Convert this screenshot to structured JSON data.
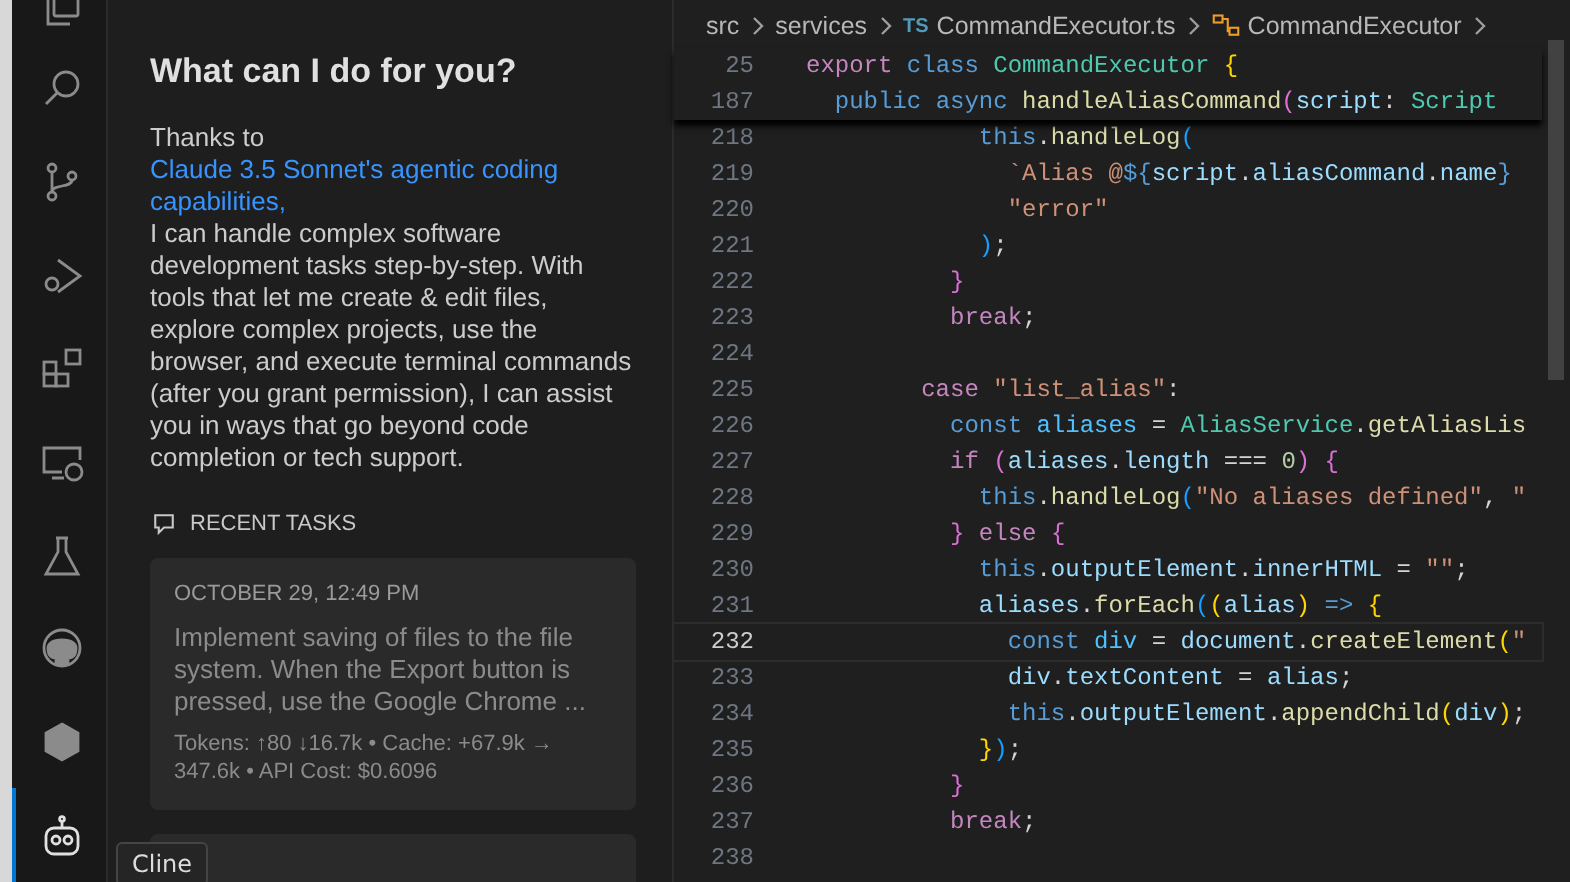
{
  "activity_bar": {
    "items": [
      {
        "kind": "files",
        "selected": false
      },
      {
        "kind": "search",
        "selected": false
      },
      {
        "kind": "git",
        "selected": false
      },
      {
        "kind": "debug",
        "selected": false
      },
      {
        "kind": "extensions",
        "selected": false
      },
      {
        "kind": "remote",
        "selected": false
      },
      {
        "kind": "flask",
        "selected": false
      },
      {
        "kind": "github",
        "selected": false
      },
      {
        "kind": "hexagon",
        "selected": false
      },
      {
        "kind": "robot",
        "selected": true
      }
    ],
    "tooltip": "Cline"
  },
  "panel": {
    "heading": "What can I do for you?",
    "intro": {
      "before": "Thanks to ",
      "link": "Claude 3.5 Sonnet's agentic coding capabilities,",
      "after": " I can handle complex software development tasks step-by-step. With tools that let me create & edit files, explore complex projects, use the browser, and execute terminal commands (after you grant permission), I can assist you in ways that go beyond code completion or tech support."
    },
    "recent_tasks_label": "RECENT TASKS",
    "tasks": [
      {
        "date": "OCTOBER 29, 12:49 PM",
        "text": "Implement saving of files to the file system. When the Export button is pressed, use the Google Chrome ...",
        "tokens": "Tokens: ↑80 ↓16.7k • Cache: +67.9k → 347.6k • API Cost: $0.6096"
      }
    ]
  },
  "editor": {
    "breadcrumb": [
      {
        "kind": "folder",
        "text": "src"
      },
      {
        "kind": "folder",
        "text": "services"
      },
      {
        "kind": "file",
        "badge": "TS",
        "text": "CommandExecutor.ts"
      },
      {
        "kind": "class",
        "text": "CommandExecutor"
      }
    ],
    "sticky": [
      {
        "n": "25",
        "tokens": [
          {
            "kind": "keyword",
            "text": "export "
          },
          {
            "kind": "storage",
            "text": "class "
          },
          {
            "kind": "type",
            "text": "CommandExecutor "
          },
          {
            "kind": "bracket1",
            "text": "{"
          }
        ]
      },
      {
        "n": "187",
        "tokens": [
          {
            "kind": "storage",
            "text": "  public "
          },
          {
            "kind": "storage",
            "text": "async "
          },
          {
            "kind": "function",
            "text": "handleAliasCommand"
          },
          {
            "kind": "bracket2",
            "text": "("
          },
          {
            "kind": "variable",
            "text": "script"
          },
          {
            "kind": "plain",
            "text": ": "
          },
          {
            "kind": "type",
            "text": "Script"
          }
        ]
      }
    ],
    "lines": [
      {
        "n": "218",
        "current": false,
        "tokens": [
          {
            "kind": "storage",
            "text": "            this"
          },
          {
            "kind": "plain",
            "text": "."
          },
          {
            "kind": "function",
            "text": "handleLog"
          },
          {
            "kind": "bracket3",
            "text": "("
          }
        ]
      },
      {
        "n": "219",
        "current": false,
        "tokens": [
          {
            "kind": "string",
            "text": "              `Alias @"
          },
          {
            "kind": "storage",
            "text": "${"
          },
          {
            "kind": "variable",
            "text": "script"
          },
          {
            "kind": "plain",
            "text": "."
          },
          {
            "kind": "variable",
            "text": "aliasCommand"
          },
          {
            "kind": "plain",
            "text": "."
          },
          {
            "kind": "variable",
            "text": "name"
          },
          {
            "kind": "storage",
            "text": "}"
          }
        ]
      },
      {
        "n": "220",
        "current": false,
        "tokens": [
          {
            "kind": "string",
            "text": "              \"error\""
          }
        ]
      },
      {
        "n": "221",
        "current": false,
        "tokens": [
          {
            "kind": "bracket3",
            "text": "            )"
          },
          {
            "kind": "plain",
            "text": ";"
          }
        ]
      },
      {
        "n": "222",
        "current": false,
        "tokens": [
          {
            "kind": "bracket2",
            "text": "          }"
          }
        ]
      },
      {
        "n": "223",
        "current": false,
        "tokens": [
          {
            "kind": "keyword",
            "text": "          break"
          },
          {
            "kind": "plain",
            "text": ";"
          }
        ]
      },
      {
        "n": "224",
        "current": false
      },
      {
        "n": "225",
        "current": false,
        "tokens": [
          {
            "kind": "keyword",
            "text": "        case "
          },
          {
            "kind": "string",
            "text": "\"list_alias\""
          },
          {
            "kind": "plain",
            "text": ":"
          }
        ]
      },
      {
        "n": "226",
        "current": false,
        "tokens": [
          {
            "kind": "storage",
            "text": "          const "
          },
          {
            "kind": "constant",
            "text": "aliases "
          },
          {
            "kind": "plain",
            "text": "= "
          },
          {
            "kind": "type",
            "text": "AliasService"
          },
          {
            "kind": "plain",
            "text": "."
          },
          {
            "kind": "function",
            "text": "getAliasLis"
          }
        ]
      },
      {
        "n": "227",
        "current": false,
        "tokens": [
          {
            "kind": "keyword",
            "text": "          if "
          },
          {
            "kind": "bracket2",
            "text": "("
          },
          {
            "kind": "variable",
            "text": "aliases"
          },
          {
            "kind": "plain",
            "text": "."
          },
          {
            "kind": "variable",
            "text": "length "
          },
          {
            "kind": "plain",
            "text": "=== "
          },
          {
            "kind": "number",
            "text": "0"
          },
          {
            "kind": "bracket2",
            "text": ") {"
          }
        ]
      },
      {
        "n": "228",
        "current": false,
        "tokens": [
          {
            "kind": "storage",
            "text": "            this"
          },
          {
            "kind": "plain",
            "text": "."
          },
          {
            "kind": "function",
            "text": "handleLog"
          },
          {
            "kind": "bracket3",
            "text": "("
          },
          {
            "kind": "string",
            "text": "\"No aliases defined\""
          },
          {
            "kind": "plain",
            "text": ", "
          },
          {
            "kind": "string",
            "text": "\""
          }
        ]
      },
      {
        "n": "229",
        "current": false,
        "tokens": [
          {
            "kind": "bracket2",
            "text": "          } "
          },
          {
            "kind": "keyword",
            "text": "else "
          },
          {
            "kind": "bracket2",
            "text": "{"
          }
        ]
      },
      {
        "n": "230",
        "current": false,
        "tokens": [
          {
            "kind": "storage",
            "text": "            this"
          },
          {
            "kind": "plain",
            "text": "."
          },
          {
            "kind": "variable",
            "text": "outputElement"
          },
          {
            "kind": "plain",
            "text": "."
          },
          {
            "kind": "variable",
            "text": "innerHTML "
          },
          {
            "kind": "plain",
            "text": "= "
          },
          {
            "kind": "string",
            "text": "\"\""
          },
          {
            "kind": "plain",
            "text": ";"
          }
        ]
      },
      {
        "n": "231",
        "current": false,
        "tokens": [
          {
            "kind": "variable",
            "text": "            aliases"
          },
          {
            "kind": "plain",
            "text": "."
          },
          {
            "kind": "function",
            "text": "forEach"
          },
          {
            "kind": "bracket3",
            "text": "("
          },
          {
            "kind": "bracket1",
            "text": "("
          },
          {
            "kind": "variable",
            "text": "alias"
          },
          {
            "kind": "bracket1",
            "text": ") "
          },
          {
            "kind": "storage",
            "text": "=> "
          },
          {
            "kind": "bracket1",
            "text": "{"
          }
        ]
      },
      {
        "n": "232",
        "current": true,
        "tokens": [
          {
            "kind": "storage",
            "text": "              const "
          },
          {
            "kind": "constant",
            "text": "div "
          },
          {
            "kind": "plain",
            "text": "= "
          },
          {
            "kind": "variable",
            "text": "document"
          },
          {
            "kind": "plain",
            "text": "."
          },
          {
            "kind": "function",
            "text": "createElement"
          },
          {
            "kind": "bracket1",
            "text": "("
          },
          {
            "kind": "string",
            "text": "\""
          }
        ]
      },
      {
        "n": "233",
        "current": false,
        "tokens": [
          {
            "kind": "variable",
            "text": "              div"
          },
          {
            "kind": "plain",
            "text": "."
          },
          {
            "kind": "variable",
            "text": "textContent "
          },
          {
            "kind": "plain",
            "text": "= "
          },
          {
            "kind": "variable",
            "text": "alias"
          },
          {
            "kind": "plain",
            "text": ";"
          }
        ]
      },
      {
        "n": "234",
        "current": false,
        "tokens": [
          {
            "kind": "storage",
            "text": "              this"
          },
          {
            "kind": "plain",
            "text": "."
          },
          {
            "kind": "variable",
            "text": "outputElement"
          },
          {
            "kind": "plain",
            "text": "."
          },
          {
            "kind": "function",
            "text": "appendChild"
          },
          {
            "kind": "bracket1",
            "text": "("
          },
          {
            "kind": "variable",
            "text": "div"
          },
          {
            "kind": "bracket1",
            "text": ")"
          },
          {
            "kind": "plain",
            "text": ";"
          }
        ]
      },
      {
        "n": "235",
        "current": false,
        "tokens": [
          {
            "kind": "bracket1",
            "text": "            }"
          },
          {
            "kind": "bracket3",
            "text": ")"
          },
          {
            "kind": "plain",
            "text": ";"
          }
        ]
      },
      {
        "n": "236",
        "current": false,
        "tokens": [
          {
            "kind": "bracket2",
            "text": "          }"
          }
        ]
      },
      {
        "n": "237",
        "current": false,
        "tokens": [
          {
            "kind": "keyword",
            "text": "          break"
          },
          {
            "kind": "plain",
            "text": ";"
          }
        ]
      },
      {
        "n": "238",
        "current": false
      }
    ]
  }
}
